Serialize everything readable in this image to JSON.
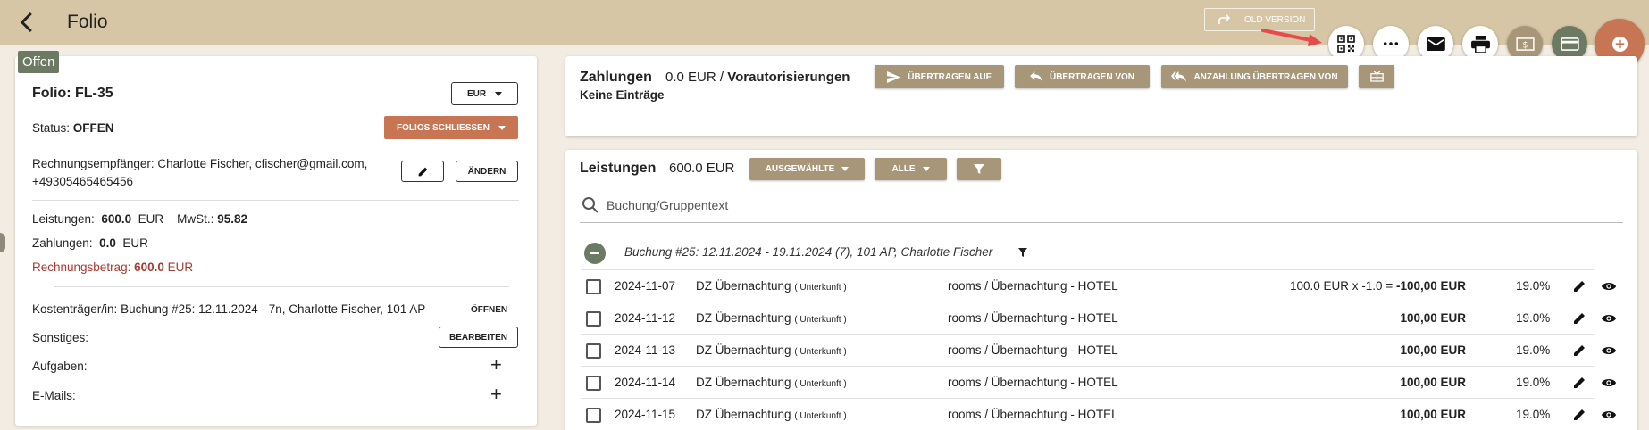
{
  "header": {
    "title": "Folio",
    "old_version_label": "OLD VERSION"
  },
  "colors": {
    "topbar": "#d6c6a6",
    "accent_tan": "#a89679",
    "accent_green": "#6d7a63",
    "accent_orange": "#c77553",
    "danger_text": "#a83a31"
  },
  "toolbar_icons": [
    "qr-code-icon",
    "more-icon",
    "mail-icon",
    "print-icon",
    "cash-icon",
    "credit-card-icon",
    "add-icon"
  ],
  "left": {
    "badge": "Offen",
    "folio_title": "Folio: FL-35",
    "currency": "EUR",
    "status_label": "Status:",
    "status_value": "OFFEN",
    "close_folios_label": "FOLIOS SCHLIESSEN",
    "recipient_label": "Rechnungsempfänger:",
    "recipient_value": "Charlotte Fischer, cfischer@gmail.com,",
    "recipient_phone": "+49305465465456",
    "change_label": "ÄNDERN",
    "services_label": "Leistungen:",
    "services_value": "600.0",
    "services_currency": "EUR",
    "vat_label": "MwSt.:",
    "vat_value": "95.82",
    "payments_label": "Zahlungen:",
    "payments_value": "0.0",
    "payments_currency": "EUR",
    "invoice_label": "Rechnungsbetrag:",
    "invoice_value": "600.0",
    "invoice_currency": "EUR",
    "cost_bearer_label": "Kostenträger/in:",
    "cost_bearer_value": "Buchung #25: 12.11.2024 - 7n, Charlotte Fischer, 101 AP",
    "open_label": "ÖFFNEN",
    "misc_label": "Sonstiges:",
    "edit_label": "BEARBEITEN",
    "tasks_label": "Aufgaben:",
    "emails_label": "E-Mails:"
  },
  "payments": {
    "title": "Zahlungen",
    "amount": "0.0 EUR /",
    "preauth_label": "Vorautorisierungen",
    "transfer_to": "ÜBERTRAGEN AUF",
    "transfer_from": "ÜBERTRAGEN VON",
    "transfer_deposit": "ANZAHLUNG ÜBERTRAGEN VON",
    "empty_text": "Keine Einträge"
  },
  "services": {
    "title": "Leistungen",
    "amount": "600.0 EUR",
    "selected_label": "AUSGEWÄHLTE",
    "all_label": "ALLE",
    "search_placeholder": "Buchung/Gruppentext",
    "group_text": "Buchung #25: 12.11.2024 - 19.11.2024 (7), 101 AP, Charlotte Fischer",
    "rows": [
      {
        "date": "2024-11-07",
        "desc": "DZ Übernachtung",
        "type": "( Unterkunft )",
        "category": "rooms / Übernachtung - HOTEL",
        "amount_prefix": "100.0 EUR x -1.0 = ",
        "amount": "-100,00 EUR",
        "vat": "19.0%"
      },
      {
        "date": "2024-11-12",
        "desc": "DZ Übernachtung",
        "type": "( Unterkunft )",
        "category": "rooms / Übernachtung - HOTEL",
        "amount_prefix": "",
        "amount": "100,00 EUR",
        "vat": "19.0%"
      },
      {
        "date": "2024-11-13",
        "desc": "DZ Übernachtung",
        "type": "( Unterkunft )",
        "category": "rooms / Übernachtung - HOTEL",
        "amount_prefix": "",
        "amount": "100,00 EUR",
        "vat": "19.0%"
      },
      {
        "date": "2024-11-14",
        "desc": "DZ Übernachtung",
        "type": "( Unterkunft )",
        "category": "rooms / Übernachtung - HOTEL",
        "amount_prefix": "",
        "amount": "100,00 EUR",
        "vat": "19.0%"
      },
      {
        "date": "2024-11-15",
        "desc": "DZ Übernachtung",
        "type": "( Unterkunft )",
        "category": "rooms / Übernachtung - HOTEL",
        "amount_prefix": "",
        "amount": "100,00 EUR",
        "vat": "19.0%"
      }
    ]
  }
}
